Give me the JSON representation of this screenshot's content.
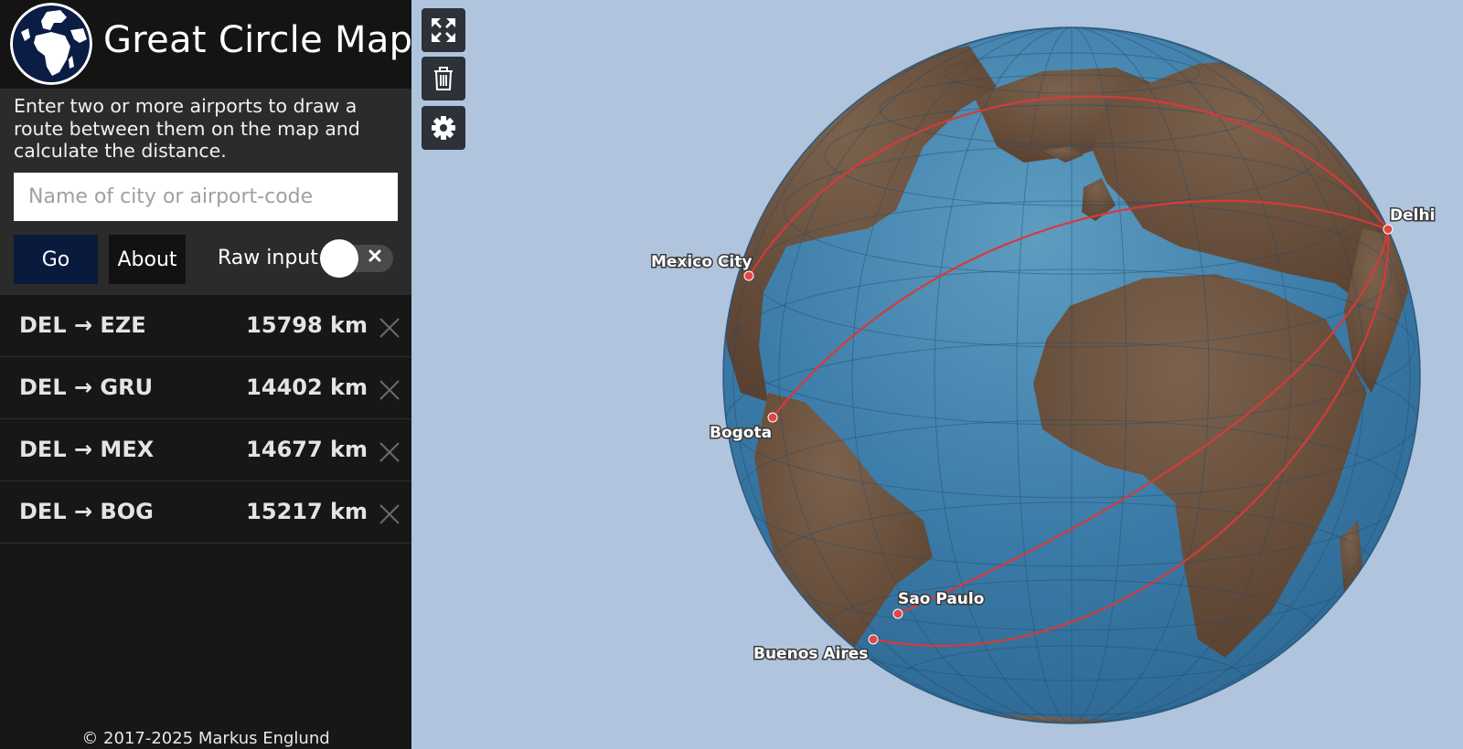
{
  "app": {
    "title": "Great Circle Map"
  },
  "controls": {
    "intro": "Enter two or more airports to draw a route between them on the map and calculate the distance.",
    "search_placeholder": "Name of city or airport-code",
    "go_label": "Go",
    "about_label": "About",
    "raw_input_label": "Raw input",
    "raw_input_enabled": false
  },
  "routes": [
    {
      "name": "DEL → EZE",
      "distance": "15798 km"
    },
    {
      "name": "DEL → GRU",
      "distance": "14402 km"
    },
    {
      "name": "DEL → MEX",
      "distance": "14677 km"
    },
    {
      "name": "DEL → BOG",
      "distance": "15217 km"
    }
  ],
  "map": {
    "cities": [
      "Mexico City",
      "Bogota",
      "Sao Paulo",
      "Buenos Aires",
      "Delhi"
    ],
    "route_color": "#d63a3a",
    "ocean_color": "#2e6f9e",
    "land_color": "#6b4f3a",
    "background_color": "#b0c4de"
  },
  "toolbar": {
    "fullscreen_icon": "expand-icon",
    "clear_icon": "trash-icon",
    "settings_icon": "gear-icon"
  },
  "footer": {
    "copyright": "© 2017-2025 Markus Englund"
  }
}
